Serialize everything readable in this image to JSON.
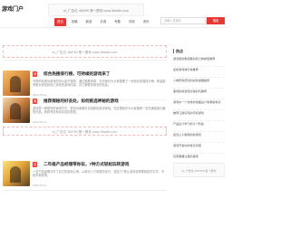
{
  "header": {
    "logo": "游戏门户",
    "top_ad": "id_广告位 468*60 第一屏到 www.9bbafe.com",
    "nav": [
      "首页",
      "攻略",
      "新游",
      "手游",
      "专题",
      "评测",
      "资讯"
    ],
    "search_placeholder": "请输入关键字",
    "search_button": "搜索"
  },
  "banners": {
    "top": "id_广告位 468*60 第一屏到 www.9bbafe.com",
    "middle": "id_广告位 760*90 第一屏到 www.9bbafe.com"
  },
  "articles": [
    {
      "tag": "综",
      "title": "综合热搜排行榜，可持续的游戏来了",
      "summary": "不同的玩家对游戏的评价各不相同，通过数据来看，今天我们为大家整理了一份综合热搜排行榜，希望能帮助大家找到自己喜欢的游戏内容，并了解更多相关的信息。",
      "date": "2023-05-12"
    },
    {
      "tag": "推",
      "title": "推荐探秘的好去处，如何挑选神秘的游戏",
      "summary": "游戏是一种很好的休闲方式，很多玩家都在寻找新的游戏体验。在这里我们为大家推荐一些充满探索乐趣的作品，看看有没有你喜欢的类型。",
      "date": "2023-05-12"
    },
    {
      "tag": "攻",
      "title": "二年级产品经理带你玩，7种方式轻松玩转游戏",
      "summary": "一名产品经理分享了自己的游戏心得，从新手入门到进阶技巧，总结了7种让游戏变得更轻松的方式，不妨来看看吧。",
      "date": "2023-05-12"
    }
  ],
  "sidebar": {
    "title": "热点",
    "items": [
      "游戏里的数值策划有几种类型推荐",
      "最新游戏排行榜推荐",
      "人物形象研究的最新发展趋势",
      "事项的新游戏比较好玩推荐",
      "游戏中一个优秀的地图设计有哪些特点",
      "推荐几款好玩的手机游戏",
      "产品设计学习的几个阶段",
      "最近让人期待的新游戏",
      "游戏开发中的常见问题",
      "玩家需要注意的事项"
    ],
    "ad": "id_广告位 250*250 第一屏到"
  }
}
